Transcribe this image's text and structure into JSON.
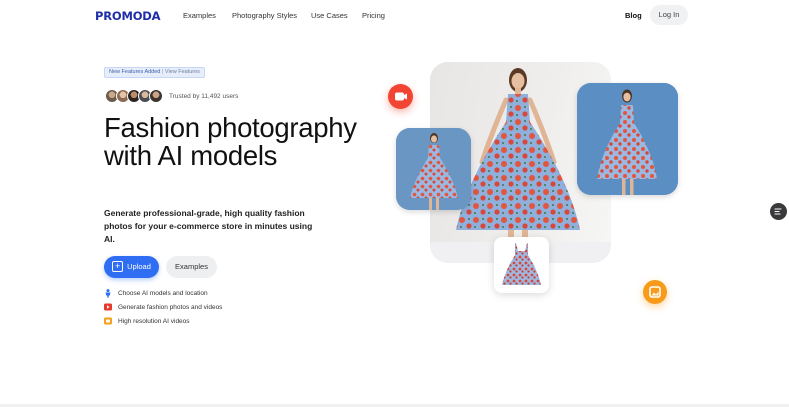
{
  "nav": {
    "logo": "PROMODA",
    "links": [
      "Examples",
      "Photography Styles",
      "Use Cases",
      "Pricing"
    ],
    "blog": "Blog",
    "login": "Log In"
  },
  "hero": {
    "pill_new": "New Features Added",
    "pill_sep": "|",
    "pill_view": "View Features",
    "trusted": "Trusted by 11,492 users",
    "headline": "Fashion photography with AI models",
    "subheadline": "Generate professional-grade, high quality fashion photos for your e-commerce store in minutes using AI.",
    "upload_label": "Upload",
    "examples_label": "Examples",
    "features": [
      {
        "label": "Choose AI models and location",
        "icon": "person-icon"
      },
      {
        "label": "Generate fashion photos and videos",
        "icon": "video-icon"
      },
      {
        "label": "High resolution AI videos",
        "icon": "film-icon"
      }
    ]
  },
  "colors": {
    "brand": "#1f2ea8",
    "accent_blue": "#2f6df2",
    "badge_red": "#f24433",
    "badge_orange": "#f89a1a",
    "dress_blue": "#8fb0dd",
    "dress_red": "#e2553f"
  }
}
